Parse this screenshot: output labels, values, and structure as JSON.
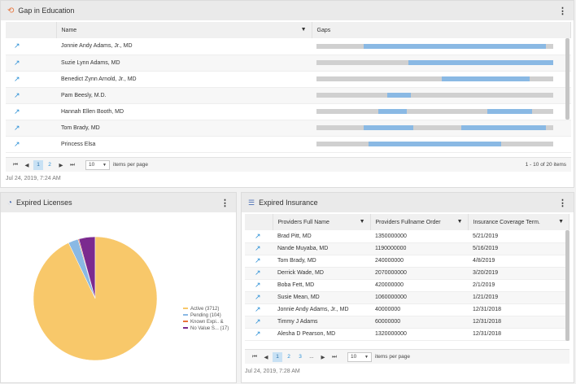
{
  "gap_panel": {
    "title": "Gap in Education",
    "col_name": "Name",
    "col_gaps": "Gaps",
    "rows": [
      {
        "name": "Jonnie Andy Adams, Jr., MD",
        "segments": [
          [
            0.2,
            0.97
          ]
        ]
      },
      {
        "name": "Suzie Lynn Adams, MD",
        "segments": [
          [
            0.39,
            1.0
          ]
        ]
      },
      {
        "name": "Benedict Zynn Arnold, Jr., MD",
        "segments": [
          [
            0.53,
            0.9
          ]
        ]
      },
      {
        "name": "Pam Beesly, M.D.",
        "segments": [
          [
            0.3,
            0.4
          ]
        ]
      },
      {
        "name": "Hannah Ellen Booth, MD",
        "segments": [
          [
            0.26,
            0.38
          ],
          [
            0.72,
            0.91
          ]
        ]
      },
      {
        "name": "Tom Brady, MD",
        "segments": [
          [
            0.2,
            0.41
          ],
          [
            0.61,
            0.97
          ]
        ]
      },
      {
        "name": "Princess Elsa",
        "segments": [
          [
            0.22,
            0.78
          ]
        ]
      }
    ],
    "pager": {
      "pages": [
        "1",
        "2"
      ],
      "per_page": "10",
      "per_page_label": "items per page",
      "range": "1 - 10 of 20 items"
    },
    "timestamp": "Jul 24, 2019, 7:24 AM"
  },
  "licenses_panel": {
    "title": "Expired Licenses",
    "legend": [
      {
        "label": "Active (3712)",
        "color": "#f8c86a"
      },
      {
        "label": "Pending (104)",
        "color": "#8ab9e4"
      },
      {
        "label": "Known Expi.. &",
        "color": "#e8743b"
      },
      {
        "label": "No Value S... (17)",
        "color": "#7b2a8f"
      }
    ],
    "chart_data": {
      "type": "pie",
      "slices": [
        {
          "name": "Active (3712)",
          "value": 3712,
          "color": "#f8c86a"
        },
        {
          "name": "Pending (104)",
          "value": 104,
          "color": "#8ab9e4"
        },
        {
          "name": "Known Expi.. &",
          "value": 10,
          "color": "#e8743b"
        },
        {
          "name": "No Value S... (17)",
          "value": 170,
          "color": "#7b2a8f"
        }
      ]
    }
  },
  "insurance_panel": {
    "title": "Expired Insurance",
    "columns": [
      "Providers Full Name",
      "Providers Fullname Order",
      "Insurance Coverage Term."
    ],
    "rows": [
      [
        "Brad Pitt, MD",
        "1350000000",
        "5/21/2019"
      ],
      [
        "Nande Muyaba, MD",
        "1190000000",
        "5/16/2019"
      ],
      [
        "Tom Brady, MD",
        "240000000",
        "4/8/2019"
      ],
      [
        "Derrick Wade, MD",
        "2070000000",
        "3/20/2019"
      ],
      [
        "Boba Fett, MD",
        "420000000",
        "2/1/2019"
      ],
      [
        "Susie Mean, MD",
        "1060000000",
        "1/21/2019"
      ],
      [
        "Jonnie Andy Adams, Jr., MD",
        "40000000",
        "12/31/2018"
      ],
      [
        "Timmy J Adams",
        "60000000",
        "12/31/2018"
      ],
      [
        "Alesha D Pearson, MD",
        "1320000000",
        "12/31/2018"
      ]
    ],
    "pager": {
      "pages": [
        "1",
        "2",
        "3",
        "..."
      ],
      "per_page": "10",
      "per_page_label": "items per page"
    },
    "timestamp": "Jul 24, 2019, 7:28 AM"
  },
  "icons": {
    "external_link": "↗",
    "kebab": "⋮",
    "first": "⏮",
    "prev": "◀",
    "next": "▶",
    "last": "⏭",
    "filter": "▼",
    "caret": "▼"
  }
}
